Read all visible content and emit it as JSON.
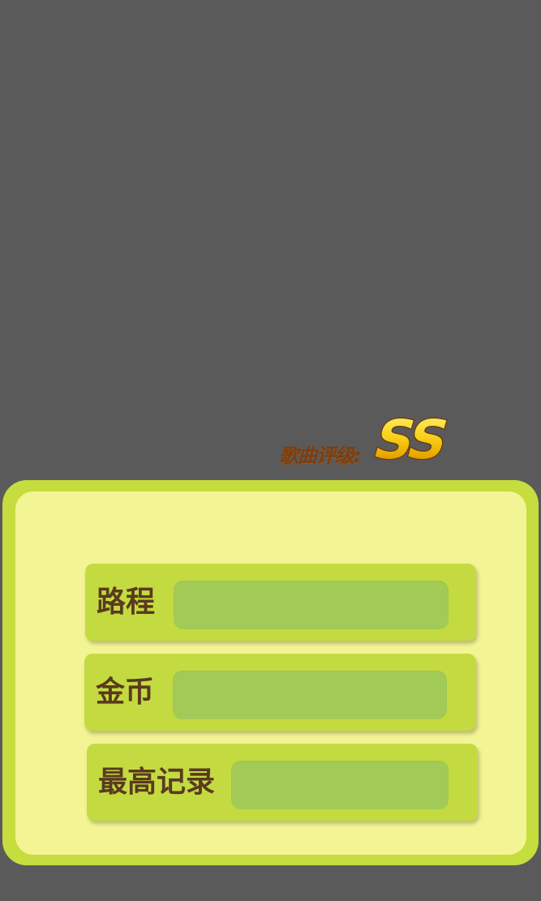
{
  "rating": {
    "label": "歌曲评级:",
    "grade": "SS"
  },
  "stats": {
    "distance": {
      "label": "路程",
      "value": ""
    },
    "coins": {
      "label": "金币",
      "value": ""
    },
    "best_record": {
      "label": "最高记录",
      "value": ""
    }
  },
  "colors": {
    "background": "#5a5a5a",
    "panel_border": "#c5dd3e",
    "panel_fill": "#f3f494",
    "row_fill": "#c3db40",
    "value_fill": "#a2ca56",
    "label_text": "#5a3a1e",
    "rating_label": "#7a3e10",
    "grade_gold": "#f5c400"
  }
}
